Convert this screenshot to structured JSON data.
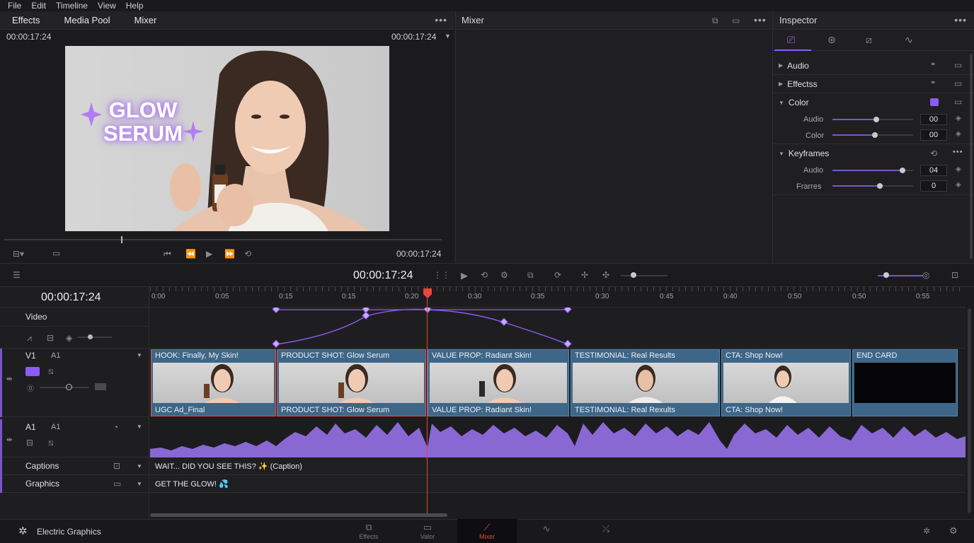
{
  "menu": [
    "File",
    "Edit",
    "Timeline",
    "View",
    "Help"
  ],
  "left_tabs": [
    "Effects",
    "Media Pool",
    "Mixer"
  ],
  "viewer": {
    "tc_left": "00:00:17:24",
    "tc_right": "00:00:17:24",
    "tc_transport": "00:00:17:24",
    "overlay_line1": "GLOW",
    "overlay_line2": "SERUM"
  },
  "mixer": {
    "title": "Mixer"
  },
  "inspector": {
    "title": "Inspector",
    "sections": [
      {
        "label": "Audio",
        "expanded": false
      },
      {
        "label": "Effectss",
        "expanded": false
      },
      {
        "label": "Color",
        "expanded": true,
        "params": [
          {
            "label": "Audio",
            "value": "00",
            "level": 0.55
          },
          {
            "label": "Color",
            "value": "00",
            "level": 0.53
          }
        ]
      },
      {
        "label": "Keyframes",
        "expanded": true,
        "params": [
          {
            "label": "Audio",
            "value": "04",
            "level": 0.87
          },
          {
            "label": "Frarres",
            "value": "0",
            "level": 0.59
          }
        ]
      }
    ]
  },
  "timeline_toolbar": {
    "timecode": "00:00:17:24"
  },
  "timeline": {
    "timecode": "00:00:17:24",
    "ruler": [
      "0:00",
      "0:05",
      "0:15",
      "0:15",
      "0:20",
      "0:30",
      "0:35",
      "0:30",
      "0:45",
      "0:40",
      "0:50",
      "0:50",
      "0:55"
    ],
    "tracks": {
      "video_label": "Video",
      "v1_label": "V1",
      "v1_sub": "A1",
      "a1_label": "A1",
      "a1_sub": "A1",
      "captions_label": "Captions",
      "graphics_label": "Graphics"
    },
    "clips": [
      {
        "top": "HOOK: Finally, My Skin!",
        "bottom": "UGC Ad_Final"
      },
      {
        "top": "PRODUCT SHOT: Glow Serum",
        "bottom": "PRODUCT SHOT: Glow Serum"
      },
      {
        "top": "VALUE PROP: Radiant Skin!",
        "bottom": "VALUE PROP: Radiant Skin!"
      },
      {
        "top": "TESTIMONIAL: Real Results",
        "bottom": "TESTIMONIAL: Real Rexults"
      },
      {
        "top": "CTA: Shop Now!",
        "bottom": "CTA: Shop Now!"
      },
      {
        "top": "END CARD",
        "bottom": ""
      }
    ],
    "caption_text": "WAIT... DID YOU SEE THIS? ✨ (Caption)",
    "graphics_text": "GET THE GLOW! 💦"
  },
  "bottom_bar": {
    "app_label": "Electric Graphics",
    "tabs": [
      "Effects",
      "Valor",
      "Mixer"
    ]
  },
  "colors": {
    "accent": "#8b5cf6",
    "playhead": "#e8463c",
    "clip": "#3d6688"
  }
}
